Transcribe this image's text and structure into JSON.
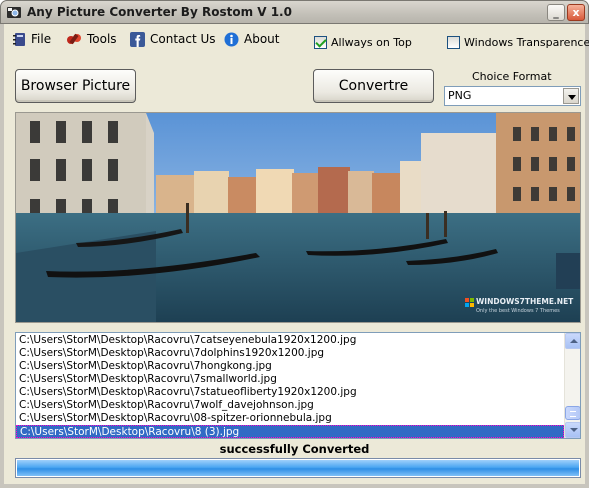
{
  "window": {
    "title": "Any Picture Converter By Rostom V 1.0",
    "min_label": "_",
    "close_label": "x"
  },
  "menu": {
    "file": "File",
    "tools": "Tools",
    "contact": "Contact Us",
    "about": "About"
  },
  "options": {
    "always_on_top": {
      "label": "Allways on Top",
      "checked": true
    },
    "windows_transparence": {
      "label": "Windows Transparence",
      "checked": false
    }
  },
  "buttons": {
    "browse": "Browser Picture",
    "convert": "Convertre"
  },
  "format": {
    "label": "Choice Format",
    "selected": "PNG"
  },
  "preview": {
    "watermark_line1": "WINDOWS7THEME.NET",
    "watermark_line2": "Only the best Windows 7 Themes"
  },
  "files": [
    {
      "path": "C:\\Users\\StorM\\Desktop\\Racovru\\7catseyenebula1920x1200.jpg",
      "selected": false
    },
    {
      "path": "C:\\Users\\StorM\\Desktop\\Racovru\\7dolphins1920x1200.jpg",
      "selected": false
    },
    {
      "path": "C:\\Users\\StorM\\Desktop\\Racovru\\7hongkong.jpg",
      "selected": false
    },
    {
      "path": "C:\\Users\\StorM\\Desktop\\Racovru\\7smallworld.jpg",
      "selected": false
    },
    {
      "path": "C:\\Users\\StorM\\Desktop\\Racovru\\7statueofliberty1920x1200.jpg",
      "selected": false
    },
    {
      "path": "C:\\Users\\StorM\\Desktop\\Racovru\\7wolf_davejohnson.jpg",
      "selected": false
    },
    {
      "path": "C:\\Users\\StorM\\Desktop\\Racovru\\08-spitzer-orionnebula.jpg",
      "selected": false
    },
    {
      "path": "C:\\Users\\StorM\\Desktop\\Racovru\\8 (3).jpg",
      "selected": true
    }
  ],
  "status": {
    "message": "successfully Converted",
    "progress": 1.0
  },
  "icons": {
    "app": "camera-icon",
    "file": "notebook-icon",
    "tools": "tools-icon",
    "contact": "facebook-icon",
    "about": "info-icon"
  },
  "colors": {
    "selection": "#316ac5",
    "progress": "#3a96ea",
    "facebook": "#3b5998",
    "info": "#1f6fd6"
  }
}
